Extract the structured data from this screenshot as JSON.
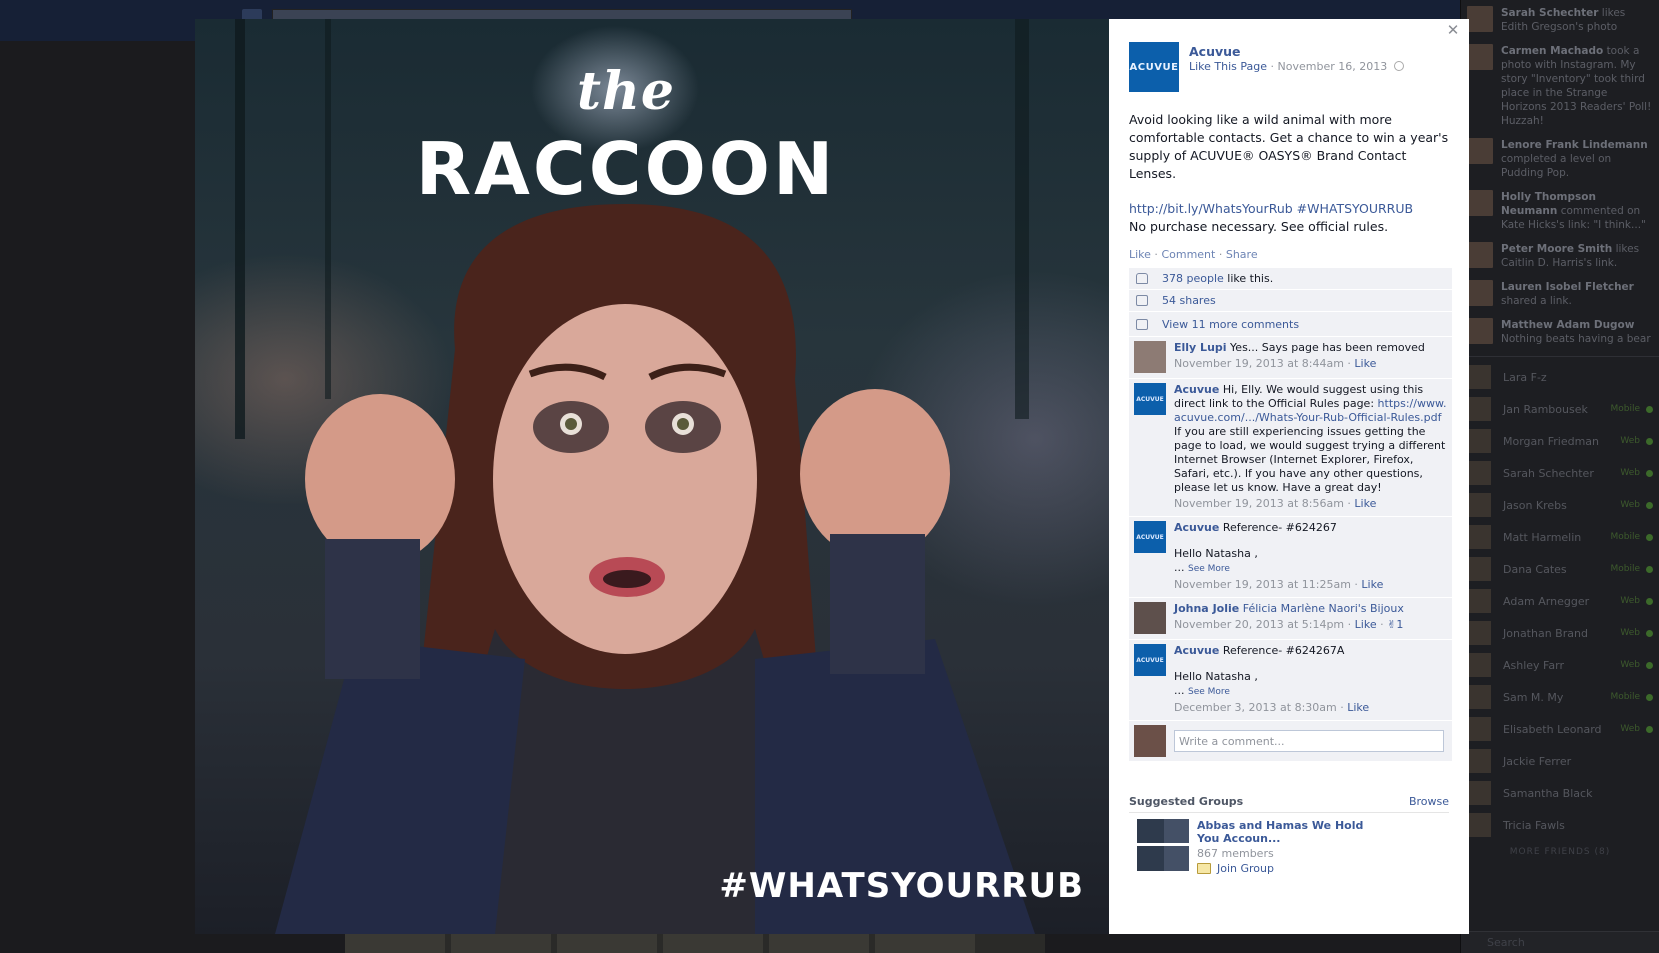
{
  "photo": {
    "overlay_the": "the",
    "overlay_headline": "RACCOON",
    "overlay_hashtag": "#WHATSYOURRUB"
  },
  "post": {
    "page_logo_text": "ACUVUE",
    "page_name": "Acuvue",
    "like_page": "Like This Page",
    "date": "November 16, 2013",
    "body": "Avoid looking like a wild animal with more comfortable contacts. Get a chance to win a year's supply of ACUVUE® OASYS® Brand Contact Lenses.",
    "link_text": "http://bit.ly/WhatsYourRub #WHATSYOURRUB",
    "fine_print": "No purchase necessary. See official rules.",
    "actions": {
      "like": "Like",
      "comment": "Comment",
      "share": "Share"
    }
  },
  "ufi": {
    "likes_link": "378 people",
    "likes_suffix": "like this.",
    "shares": "54 shares",
    "view_more": "View 11 more comments",
    "comments": [
      {
        "author": "Elly Lupi",
        "text": "Yes... Says page has been removed",
        "time": "November 19, 2013 at 8:44am",
        "like": "Like"
      },
      {
        "author": "Acuvue",
        "text": "Hi, Elly. We would suggest using this direct link to the Official Rules page:",
        "link": "https://www.acuvue.com/.../Whats-Your-Rub-Official-Rules.pdf",
        "text2": "If you are still experiencing issues getting the page to load, we would suggest trying a different Internet Browser (Internet Explorer, Firefox, Safari, etc.). If you have any other questions, please let us know. Have a great day!",
        "time": "November 19, 2013 at 8:56am",
        "like": "Like"
      },
      {
        "author": "Acuvue",
        "text": "Reference- #624267",
        "text2": "Hello Natasha ,",
        "see_more": "See More",
        "time": "November 19, 2013 at 11:25am",
        "like": "Like"
      },
      {
        "author": "Johna Jolie",
        "tag": "Félicia Marlène Naori's Bijoux",
        "time": "November 20, 2013 at 5:14pm",
        "like": "Like",
        "like_count": "1"
      },
      {
        "author": "Acuvue",
        "text": "Reference- #624267A",
        "text2": "Hello Natasha ,",
        "see_more": "See More",
        "time": "December 3, 2013 at 8:30am",
        "like": "Like"
      }
    ],
    "write_placeholder": "Write a comment..."
  },
  "suggested": {
    "title": "Suggested Groups",
    "browse": "Browse",
    "group_name": "Abbas and Hamas We Hold You Accoun...",
    "members": "867 members",
    "join": "Join Group"
  },
  "ticker": {
    "stories": [
      {
        "name": "Sarah Schechter",
        "text": "likes Edith Gregson's photo"
      },
      {
        "name": "Carmen Machado",
        "text": "took a photo with Instagram. My story \"Inventory\" took third place in the Strange Horizons 2013 Readers' Poll! Huzzah!"
      },
      {
        "name": "Lenore Frank Lindemann",
        "text": "completed a level on Pudding Pop."
      },
      {
        "name": "Holly Thompson Neumann",
        "text": "commented on Kate Hicks's link: \"I think...\""
      },
      {
        "name": "Peter Moore Smith",
        "text": "likes Caitlin D. Harris's link."
      },
      {
        "name": "Lauren Isobel Fletcher",
        "text": "shared a link."
      },
      {
        "name": "Matthew Adam Dugow",
        "text": "Nothing beats having a bear"
      }
    ],
    "chat": [
      {
        "name": "Lara F-z",
        "tag": ""
      },
      {
        "name": "Jan Rambousek",
        "tag": "Mobile"
      },
      {
        "name": "Morgan Friedman",
        "tag": "Web"
      },
      {
        "name": "Sarah Schechter",
        "tag": "Web"
      },
      {
        "name": "Jason Krebs",
        "tag": "Web"
      },
      {
        "name": "Matt Harmelin",
        "tag": "Mobile"
      },
      {
        "name": "Dana Cates",
        "tag": "Mobile"
      },
      {
        "name": "Adam Arnegger",
        "tag": "Web"
      },
      {
        "name": "Jonathan Brand",
        "tag": "Web"
      },
      {
        "name": "Ashley Farr",
        "tag": "Web"
      },
      {
        "name": "Sam M. My",
        "tag": "Mobile"
      },
      {
        "name": "Elisabeth Leonard",
        "tag": "Web"
      },
      {
        "name": "Jackie Ferrer",
        "tag": ""
      },
      {
        "name": "Samantha Black",
        "tag": ""
      },
      {
        "name": "Tricia Fawls",
        "tag": ""
      }
    ],
    "more_friends": "MORE FRIENDS (8)",
    "search": "Search"
  },
  "colors": {
    "fb_blue": "#3b5998",
    "acuvue_blue": "#0c5fab"
  }
}
